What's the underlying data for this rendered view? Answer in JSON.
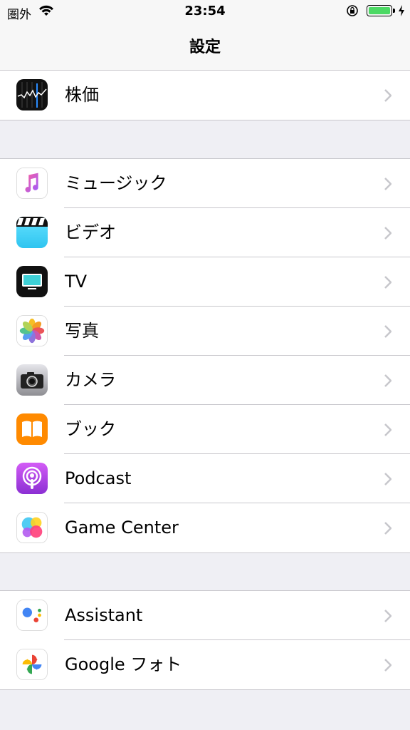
{
  "status": {
    "carrier": "圏外",
    "time": "23:54",
    "battery_color": "#4cd964"
  },
  "nav": {
    "title": "設定"
  },
  "groups": [
    {
      "rows": [
        {
          "label": "株価",
          "icon": "stocks-icon"
        }
      ]
    },
    {
      "rows": [
        {
          "label": "ミュージック",
          "icon": "music-icon"
        },
        {
          "label": "ビデオ",
          "icon": "video-icon"
        },
        {
          "label": "TV",
          "icon": "tv-icon"
        },
        {
          "label": "写真",
          "icon": "photos-icon"
        },
        {
          "label": "カメラ",
          "icon": "camera-icon"
        },
        {
          "label": "ブック",
          "icon": "books-icon"
        },
        {
          "label": "Podcast",
          "icon": "podcast-icon"
        },
        {
          "label": "Game Center",
          "icon": "game-center-icon"
        }
      ]
    },
    {
      "rows": [
        {
          "label": "Assistant",
          "icon": "assistant-icon"
        },
        {
          "label": "Google フォト",
          "icon": "google-photos-icon"
        }
      ]
    }
  ]
}
